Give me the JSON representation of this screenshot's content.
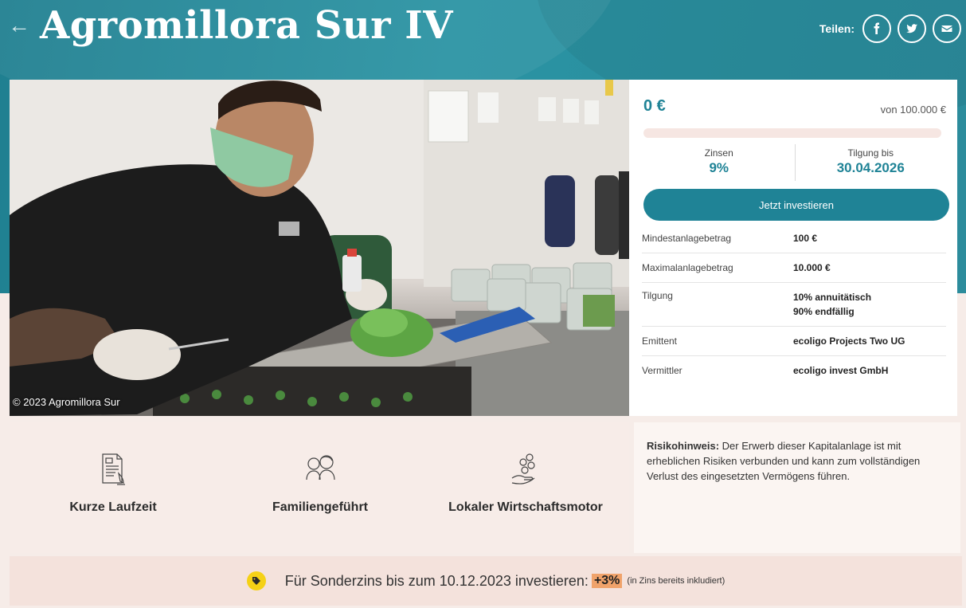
{
  "header": {
    "back_icon": "arrow-left-icon",
    "title": "Agromillora Sur IV",
    "share_label": "Teilen:",
    "share_buttons": [
      "facebook-icon",
      "twitter-icon",
      "email-icon"
    ]
  },
  "photo": {
    "caption": "© 2023 Agromillora Sur"
  },
  "investment": {
    "raised": "0 €",
    "goal": "von 100.000 €",
    "progress_fraction": 0,
    "interest_label": "Zinsen",
    "interest_value": "9%",
    "repayment_label": "Tilgung bis",
    "repayment_value": "30.04.2026",
    "cta": "Jetzt investieren",
    "details": [
      {
        "key": "Mindestanlagebetrag",
        "value": "100 €"
      },
      {
        "key": "Maximalanlagebetrag",
        "value": "10.000 €"
      },
      {
        "key": "Tilgung",
        "value": "10% annuitätisch",
        "value2": "90% endfällig"
      },
      {
        "key": "Emittent",
        "value": "ecoligo Projects Two UG"
      },
      {
        "key": "Vermittler",
        "value": "ecoligo invest GmbH"
      }
    ]
  },
  "features": [
    {
      "icon": "document-icon",
      "label": "Kurze Laufzeit"
    },
    {
      "icon": "family-icon",
      "label": "Familiengeführt"
    },
    {
      "icon": "coins-hand-icon",
      "label": "Lokaler Wirtschaftsmotor"
    }
  ],
  "risk": {
    "title": "Risikohinweis:",
    "text": "Der Erwerb dieser Kapitalanlage ist mit erheblichen Risiken verbunden und kann zum vollständigen Verlust des eingesetzten Vermögens führen."
  },
  "promo": {
    "icon": "tag-icon",
    "text": "Für Sonderzins bis zum 10.12.2023 investieren:",
    "highlight": "+3%",
    "note": "(in Zins bereits inkludiert)"
  },
  "colors": {
    "brand": "#1f8396",
    "accent_highlight": "#f0a36b",
    "tag_yellow": "#f5d116"
  }
}
